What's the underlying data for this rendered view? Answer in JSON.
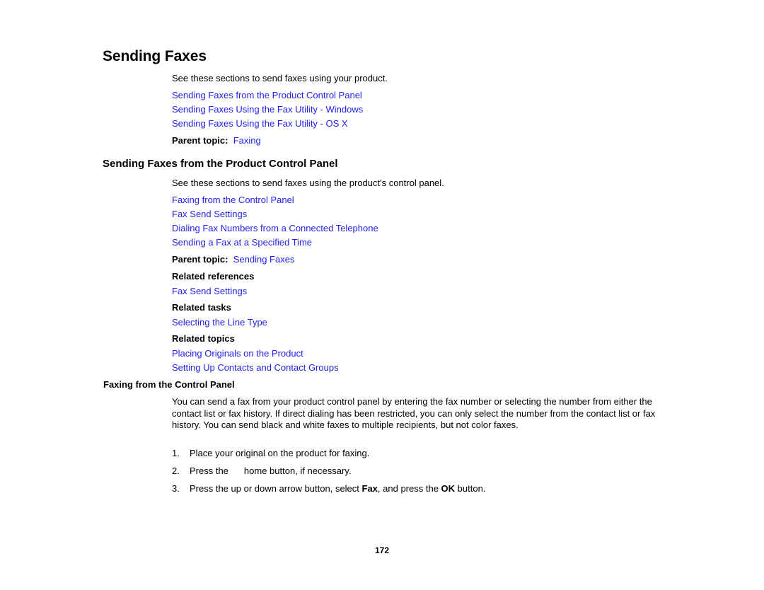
{
  "document": {
    "page_number": "172",
    "link_color": "#2222ee",
    "text_color": "#000000",
    "background_color": "#ffffff"
  },
  "section_1": {
    "heading": "Sending Faxes",
    "intro": "See these sections to send faxes using your product.",
    "links": [
      "Sending Faxes from the Product Control Panel",
      "Sending Faxes Using the Fax Utility - Windows",
      "Sending Faxes Using the Fax Utility - OS X"
    ],
    "parent_topic": {
      "label": "Parent topic:",
      "link": "Faxing"
    }
  },
  "section_2": {
    "heading": "Sending Faxes from the Product Control Panel",
    "intro": "See these sections to send faxes using the product's control panel.",
    "links": [
      "Faxing from the Control Panel",
      "Fax Send Settings",
      "Dialing Fax Numbers from a Connected Telephone",
      "Sending a Fax at a Specified Time"
    ],
    "parent_topic": {
      "label": "Parent topic:",
      "link": "Sending Faxes"
    },
    "related_references": {
      "heading": "Related references",
      "links": [
        "Fax Send Settings"
      ]
    },
    "related_tasks": {
      "heading": "Related tasks",
      "links": [
        "Selecting the Line Type"
      ]
    },
    "related_topics": {
      "heading": "Related topics",
      "links": [
        "Placing Originals on the Product",
        "Setting Up Contacts and Contact Groups"
      ]
    }
  },
  "section_3": {
    "heading": "Faxing from the Control Panel",
    "paragraph": "You can send a fax from your product control panel by entering the fax number or selecting the number from either the contact list or fax history. If direct dialing has been restricted, you can only select the number from the contact list or fax history. You can send black and white faxes to multiple recipients, but not color faxes.",
    "steps": [
      {
        "number": "1.",
        "text_before": "Place your original on the product for faxing.",
        "bold_1": "",
        "text_middle": "",
        "bold_2": "",
        "text_after": ""
      },
      {
        "number": "2.",
        "text_before": "Press the",
        "has_icon_gap": true,
        "icon_name": "home-button-icon",
        "text_after": "home button, if necessary."
      },
      {
        "number": "3.",
        "text_before": "Press the up or down arrow button, select ",
        "bold_1": "Fax",
        "text_middle": ", and press the ",
        "bold_2": "OK",
        "text_after": " button."
      }
    ]
  }
}
